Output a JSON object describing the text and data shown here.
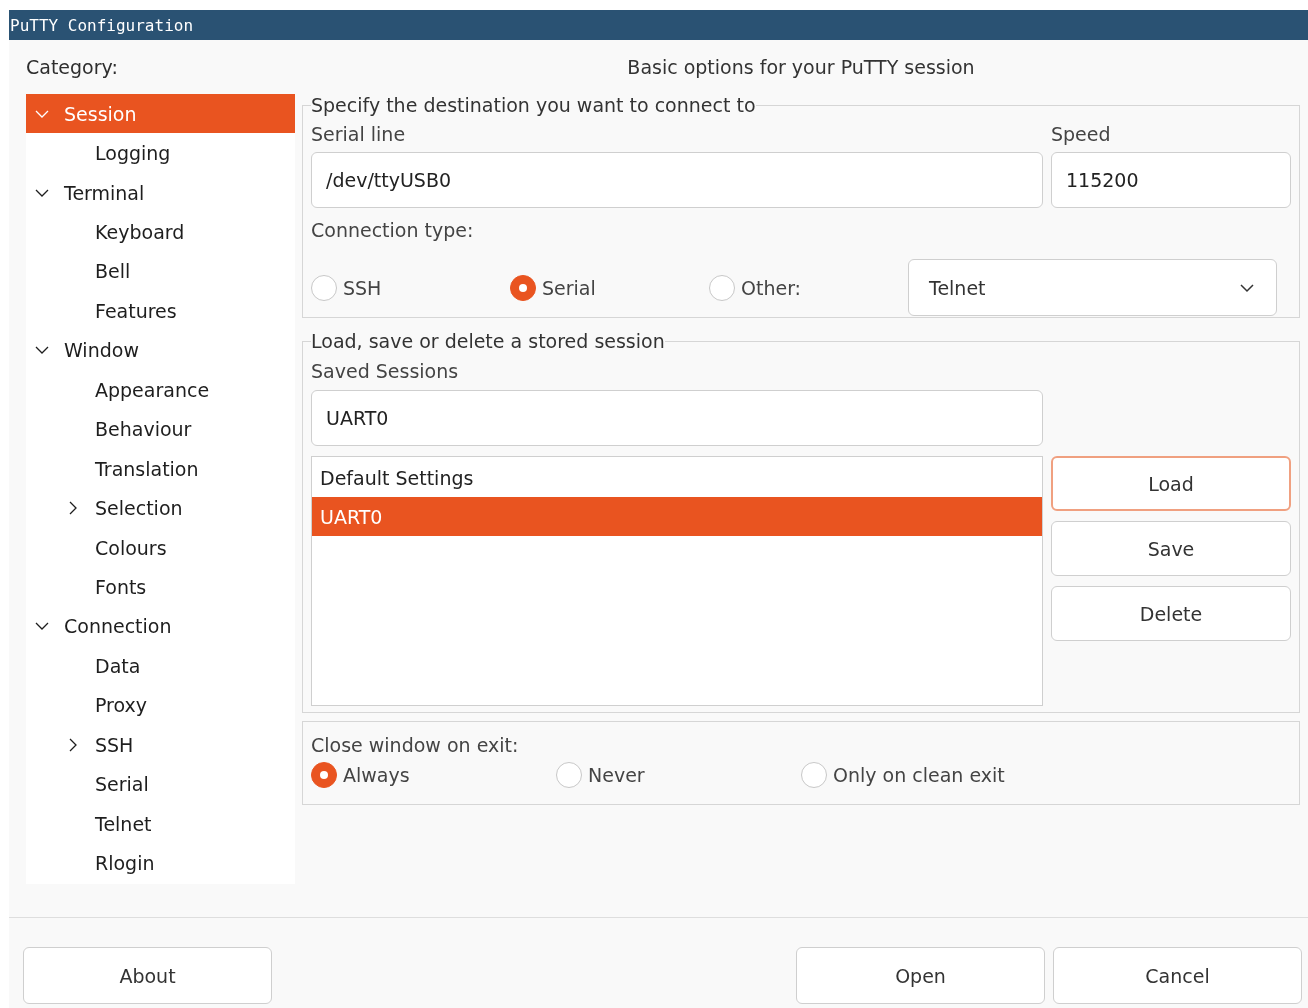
{
  "window": {
    "title": "PuTTY Configuration"
  },
  "category_label": "Category:",
  "tree": [
    {
      "label": "Session",
      "expanded": true,
      "selected": true,
      "children": [
        {
          "label": "Logging",
          "selected": false
        }
      ]
    },
    {
      "label": "Terminal",
      "expanded": true,
      "selected": false,
      "children": [
        {
          "label": "Keyboard",
          "selected": false
        },
        {
          "label": "Bell",
          "selected": false
        },
        {
          "label": "Features",
          "selected": false
        }
      ]
    },
    {
      "label": "Window",
      "expanded": true,
      "selected": false,
      "children": [
        {
          "label": "Appearance",
          "selected": false
        },
        {
          "label": "Behaviour",
          "selected": false
        },
        {
          "label": "Translation",
          "selected": false
        },
        {
          "label": "Selection",
          "expanded": false,
          "selected": false
        },
        {
          "label": "Colours",
          "selected": false
        },
        {
          "label": "Fonts",
          "selected": false
        }
      ]
    },
    {
      "label": "Connection",
      "expanded": true,
      "selected": false,
      "children": [
        {
          "label": "Data",
          "selected": false
        },
        {
          "label": "Proxy",
          "selected": false
        },
        {
          "label": "SSH",
          "expanded": false,
          "selected": false
        },
        {
          "label": "Serial",
          "selected": false
        },
        {
          "label": "Telnet",
          "selected": false
        },
        {
          "label": "Rlogin",
          "selected": false
        }
      ]
    }
  ],
  "panel_title": "Basic options for your PuTTY session",
  "destination": {
    "legend": "Specify the destination you want to connect to",
    "serial_line": {
      "label": "Serial line",
      "value": "/dev/ttyUSB0"
    },
    "speed": {
      "label": "Speed",
      "value": "115200"
    },
    "connection_type_label": "Connection type:",
    "connection_types": [
      {
        "label": "SSH",
        "selected": false
      },
      {
        "label": "Serial",
        "selected": true
      },
      {
        "label": "Other:",
        "selected": false
      }
    ],
    "other_protocol": "Telnet"
  },
  "sessions": {
    "legend": "Load, save or delete a stored session",
    "label": "Saved Sessions",
    "value": "UART0",
    "list": [
      {
        "label": "Default Settings",
        "selected": false
      },
      {
        "label": "UART0",
        "selected": true
      }
    ],
    "buttons": [
      {
        "label": "Load",
        "focused": true
      },
      {
        "label": "Save",
        "focused": false
      },
      {
        "label": "Delete",
        "focused": false
      }
    ]
  },
  "close_on_exit": {
    "label": "Close window on exit:",
    "options": [
      {
        "label": "Always",
        "selected": true
      },
      {
        "label": "Never",
        "selected": false
      },
      {
        "label": "Only on clean exit",
        "selected": false
      }
    ]
  },
  "footer_buttons": [
    {
      "label": "About"
    },
    {
      "label": "Open"
    },
    {
      "label": "Cancel"
    }
  ]
}
